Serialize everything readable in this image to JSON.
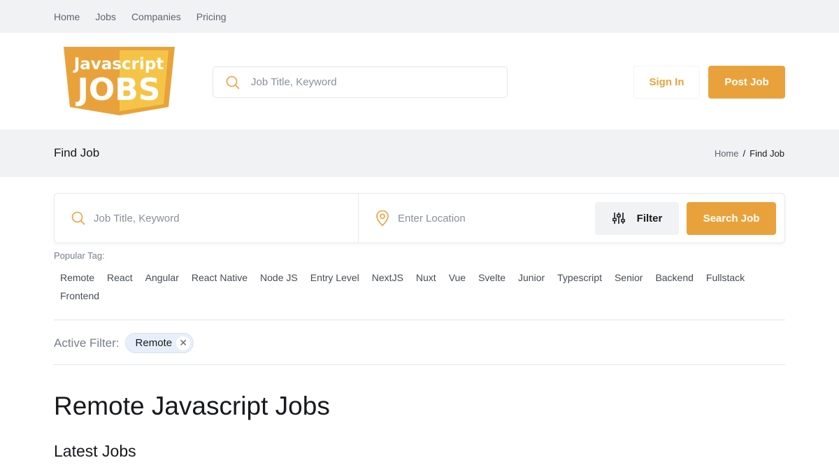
{
  "nav": {
    "items": [
      "Home",
      "Jobs",
      "Companies",
      "Pricing"
    ]
  },
  "logo": {
    "line1": "Javascript",
    "line2": "JOBS"
  },
  "header": {
    "search_placeholder": "Job Title, Keyword",
    "signin_label": "Sign In",
    "post_label": "Post Job"
  },
  "titlebar": {
    "title": "Find Job",
    "breadcrumb": {
      "home": "Home",
      "sep": "/",
      "current": "Find Job"
    }
  },
  "search": {
    "keyword_placeholder": "Job Title, Keyword",
    "location_placeholder": "Enter Location",
    "filter_label": "Filter",
    "search_label": "Search Job"
  },
  "popular": {
    "label": "Popular Tag:",
    "tags": [
      "Remote",
      "React",
      "Angular",
      "React Native",
      "Node JS",
      "Entry Level",
      "NextJS",
      "Nuxt",
      "Vue",
      "Svelte",
      "Junior",
      "Typescript",
      "Senior",
      "Backend",
      "Fullstack",
      "Frontend"
    ]
  },
  "active_filter": {
    "label": "Active Filter:",
    "chip": "Remote",
    "remove": "✕"
  },
  "headings": {
    "page": "Remote Javascript Jobs",
    "latest": "Latest Jobs"
  },
  "colors": {
    "accent": "#e9a23b",
    "muted_bg": "#f1f2f4",
    "chip_bg": "#e7f0fa"
  }
}
